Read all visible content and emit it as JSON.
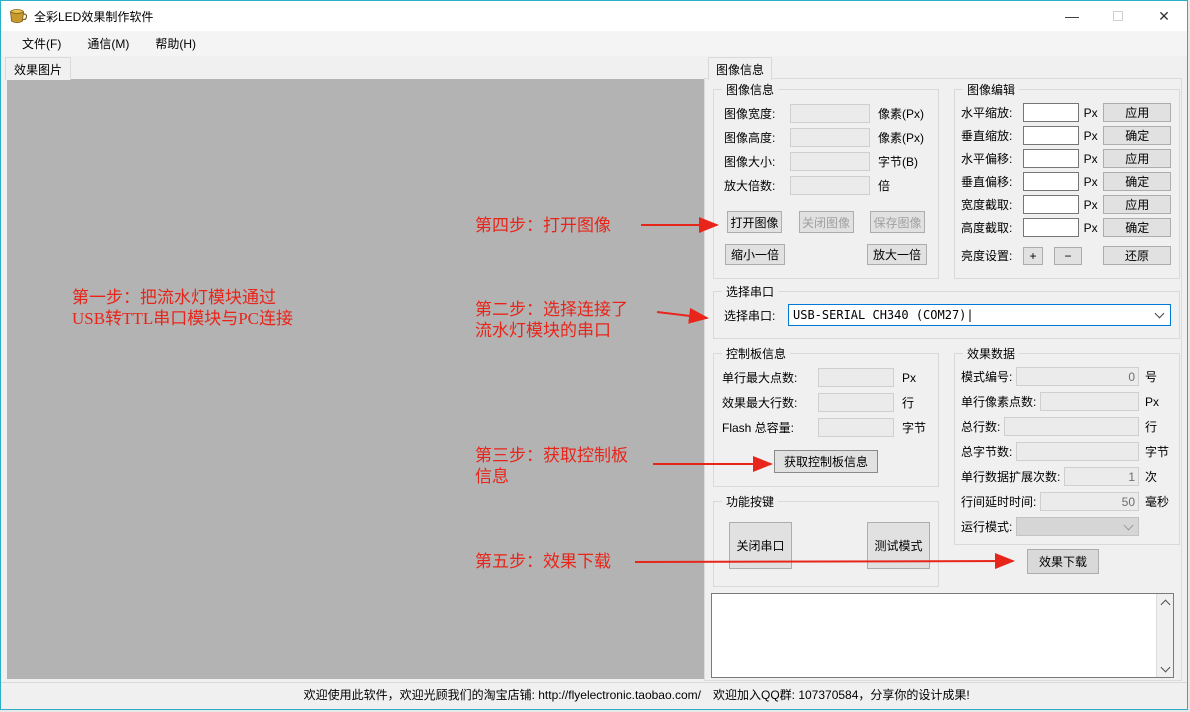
{
  "window": {
    "title": "全彩LED效果制作软件"
  },
  "titlebar": {
    "minimize_glyph": "—",
    "close_glyph": "✕"
  },
  "menu": {
    "file": "文件(F)",
    "comm": "通信(M)",
    "help": "帮助(H)"
  },
  "tabs": {
    "left": "效果图片",
    "right": "图像信息"
  },
  "annotations": {
    "step1_line1": "第一步：把流水灯模块通过",
    "step1_line2": "USB转TTL串口模块与PC连接",
    "step2_line1": "第二步：选择连接了",
    "step2_line2": "流水灯模块的串口",
    "step3_line1": "第三步：获取控制板",
    "step3_line2": "信息",
    "step4": "第四步：打开图像",
    "step5": "第五步：效果下载"
  },
  "image_info": {
    "title": "图像信息",
    "rows": [
      {
        "label": "图像宽度:",
        "value": "",
        "unit": "像素(Px)"
      },
      {
        "label": "图像高度:",
        "value": "",
        "unit": "像素(Px)"
      },
      {
        "label": "图像大小:",
        "value": "",
        "unit": "字节(B)"
      },
      {
        "label": "放大倍数:",
        "value": "",
        "unit": "倍"
      }
    ],
    "open_btn": "打开图像",
    "close_btn": "关闭图像",
    "save_btn": "保存图像",
    "zoom_out_btn": "缩小一倍",
    "zoom_in_btn": "放大一倍"
  },
  "image_edit": {
    "title": "图像编辑",
    "rows": [
      {
        "label": "水平缩放:",
        "value": "",
        "unit": "Px",
        "button": "应用"
      },
      {
        "label": "垂直缩放:",
        "value": "",
        "unit": "Px",
        "button": "确定"
      },
      {
        "label": "水平偏移:",
        "value": "",
        "unit": "Px",
        "button": "应用"
      },
      {
        "label": "垂直偏移:",
        "value": "",
        "unit": "Px",
        "button": "确定"
      },
      {
        "label": "宽度截取:",
        "value": "",
        "unit": "Px",
        "button": "应用"
      },
      {
        "label": "高度截取:",
        "value": "",
        "unit": "Px",
        "button": "确定"
      }
    ],
    "brightness_label": "亮度设置:",
    "plus_btn": "+",
    "minus_btn": "−",
    "reset_btn": "还原"
  },
  "serial": {
    "title": "选择串口",
    "label": "选择串口:",
    "value": "USB-SERIAL CH340 (COM27)|"
  },
  "board": {
    "title": "控制板信息",
    "rows": [
      {
        "label": "单行最大点数:",
        "value": "",
        "unit": "Px"
      },
      {
        "label": "效果最大行数:",
        "value": "",
        "unit": "行"
      },
      {
        "label": "Flash 总容量:",
        "value": "",
        "unit": "字节"
      }
    ],
    "get_info_btn": "获取控制板信息"
  },
  "effect": {
    "title": "效果数据",
    "rows": [
      {
        "label": "模式编号:",
        "value": "0",
        "unit": "号"
      },
      {
        "label": "单行像素点数:",
        "value": "",
        "unit": "Px"
      },
      {
        "label": "总行数:",
        "value": "",
        "unit": "行"
      },
      {
        "label": "总字节数:",
        "value": "",
        "unit": "字节"
      },
      {
        "label": "单行数据扩展次数:",
        "value": "1",
        "unit": "次"
      },
      {
        "label": "行间延时时间:",
        "value": "50",
        "unit": "毫秒"
      }
    ],
    "run_mode_label": "运行模式:",
    "run_mode_value": ""
  },
  "functions": {
    "title": "功能按键",
    "close_serial_btn": "关闭串口",
    "test_mode_btn": "测试模式",
    "download_btn": "效果下载"
  },
  "log": {
    "value": ""
  },
  "statusbar": {
    "left": "欢迎使用此软件，欢迎光顾我们的淘宝店铺: http://flyelectronic.taobao.com/",
    "right": "欢迎加入QQ群: 107370584，分享你的设计成果!"
  },
  "colors": {
    "window_border": "#2bafc4",
    "annotation_red": "#e8251a",
    "focus_blue": "#0078d7",
    "canvas_gray": "#b3b3b3"
  }
}
